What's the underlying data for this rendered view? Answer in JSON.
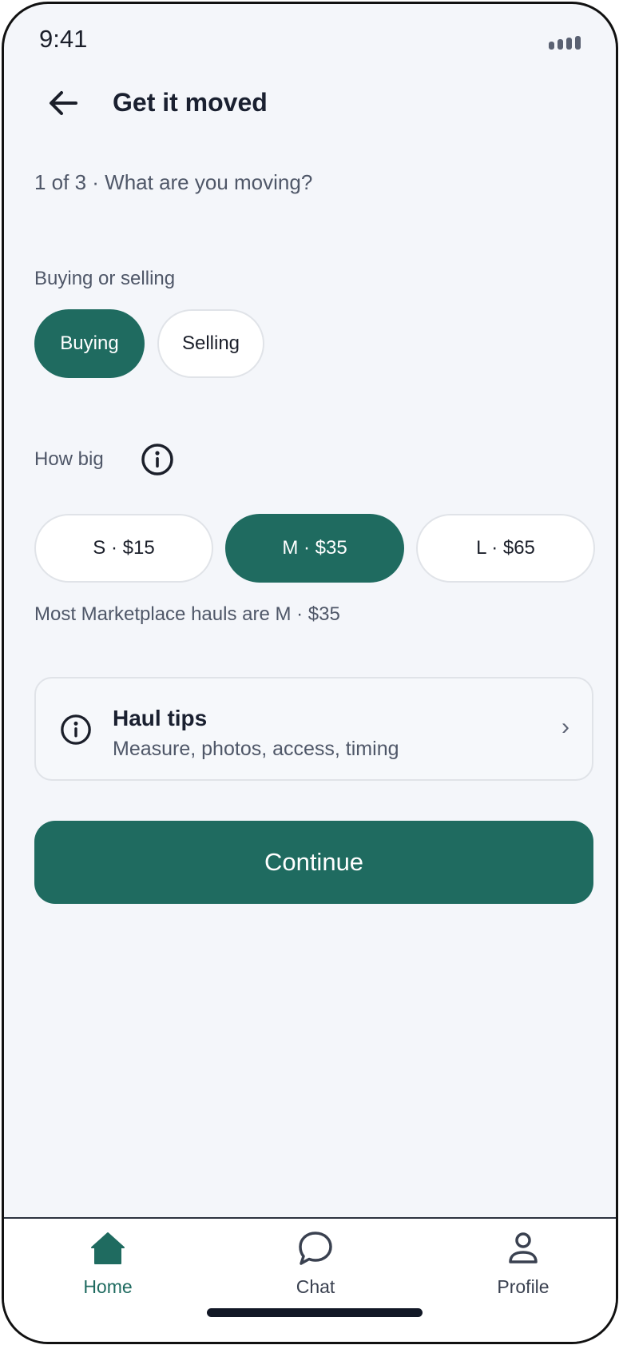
{
  "status_bar": {
    "time": "9:41"
  },
  "header": {
    "title": "Get it moved",
    "back_icon": "arrow-left-icon"
  },
  "step": {
    "text": "1 of 3 · What are you moving?"
  },
  "trade": {
    "label": "Buying or selling",
    "options": [
      "Buying",
      "Selling"
    ],
    "selected": "Buying"
  },
  "size": {
    "label": "How big",
    "options": [
      "S · $15",
      "M · $35",
      "L · $65"
    ],
    "selected": "M · $35",
    "hint": "Most Marketplace hauls are M · $35"
  },
  "tips": {
    "title": "Haul tips",
    "subtitle": "Measure, photos, access, timing",
    "chevron": "›"
  },
  "continue_label": "Continue",
  "tabs": [
    {
      "label": "Home",
      "icon": "home-icon",
      "active": true
    },
    {
      "label": "Chat",
      "icon": "chat-icon",
      "active": false
    },
    {
      "label": "Profile",
      "icon": "profile-icon",
      "active": false
    }
  ],
  "colors": {
    "accent": "#1f6b60",
    "background": "#f4f6fa",
    "text": "#1a2030",
    "muted": "#4f5768"
  }
}
